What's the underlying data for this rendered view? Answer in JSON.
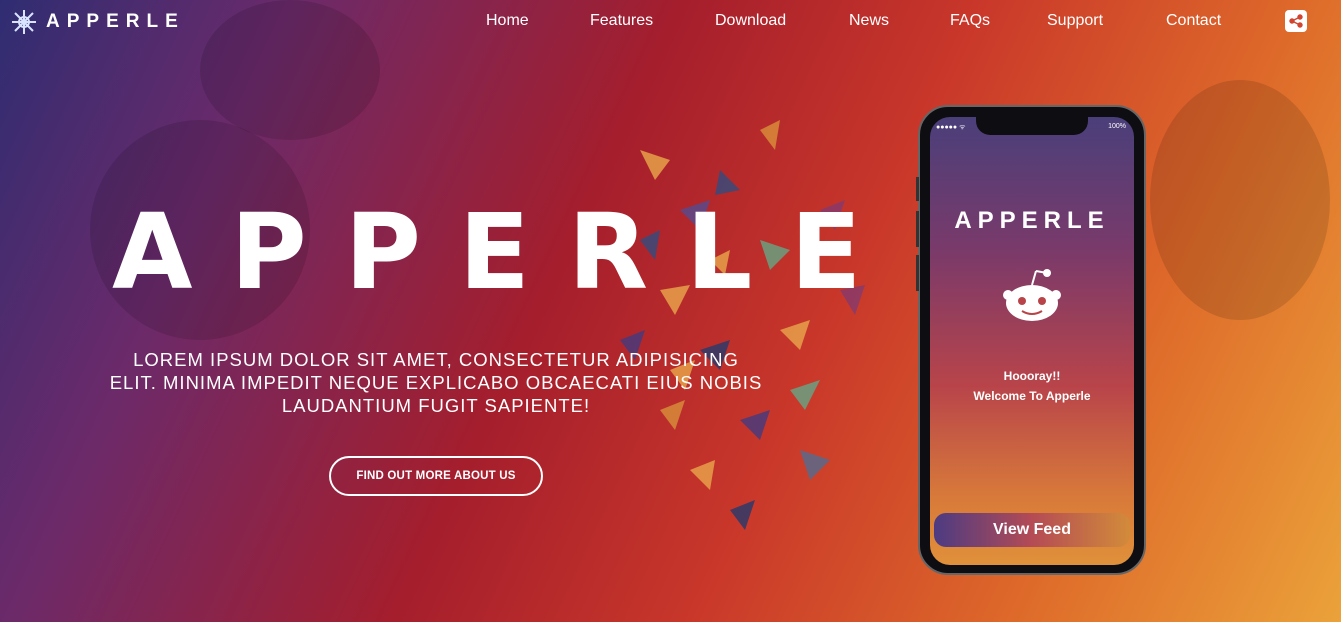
{
  "header": {
    "logo_text": "APPERLE",
    "nav": [
      "Home",
      "Features",
      "Download",
      "News",
      "FAQs",
      "Support",
      "Contact"
    ]
  },
  "hero": {
    "title": "APPERLE",
    "text": "LOREM IPSUM DOLOR SIT AMET, CONSECTETUR ADIPISICING ELIT. MINIMA IMPEDIT NEQUE EXPLICABO OBCAECATI EIUS NOBIS LAUDANTIUM FUGIT SAPIENTE!",
    "cta_label": "FIND OUT MORE ABOUT US"
  },
  "phone": {
    "status_left": "●●●●● ᯤ",
    "status_right": "100%",
    "logo": "APPERLE",
    "message_line1": "Hoooray!!",
    "message_line2": "Welcome To Apperle",
    "button_label": "View Feed"
  },
  "icons": {
    "logo": "snowflake-logo-icon",
    "share": "share-icon",
    "mascot": "reddit-alien-icon"
  },
  "colors": {
    "gradient_start": "#2f2d72",
    "gradient_mid": "#a51e2c",
    "gradient_end": "#eba23a"
  }
}
